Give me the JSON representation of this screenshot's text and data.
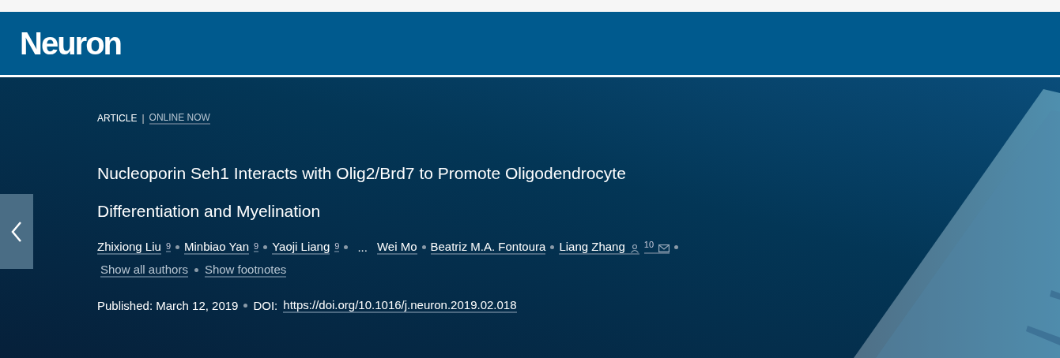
{
  "header": {
    "logo": "Neuron"
  },
  "article": {
    "type": "ARTICLE",
    "separator": "|",
    "status": "ONLINE NOW",
    "title": "Nucleoporin Seh1 Interacts with Olig2/Brd7 to Promote Oligodendrocyte Differentiation and Myelination",
    "authors": [
      {
        "kind": "author",
        "name": "Zhixiong Liu",
        "note": "9"
      },
      {
        "kind": "author",
        "name": "Minbiao Yan",
        "note": "9"
      },
      {
        "kind": "author",
        "name": "Yaoji Liang",
        "note": "9"
      },
      {
        "kind": "ellipsis",
        "name": "..."
      },
      {
        "kind": "author",
        "name": "Wei Mo"
      },
      {
        "kind": "author",
        "name": "Beatriz M.A. Fontoura"
      },
      {
        "kind": "author",
        "name": "Liang Zhang",
        "note": "10",
        "corresponding": true,
        "email": true
      }
    ],
    "links": [
      "Show all authors",
      "Show footnotes"
    ],
    "published": "Published: March 12, 2019",
    "doi_label": "DOI:",
    "doi": "https://doi.org/10.1016/j.neuron.2019.02.018"
  }
}
